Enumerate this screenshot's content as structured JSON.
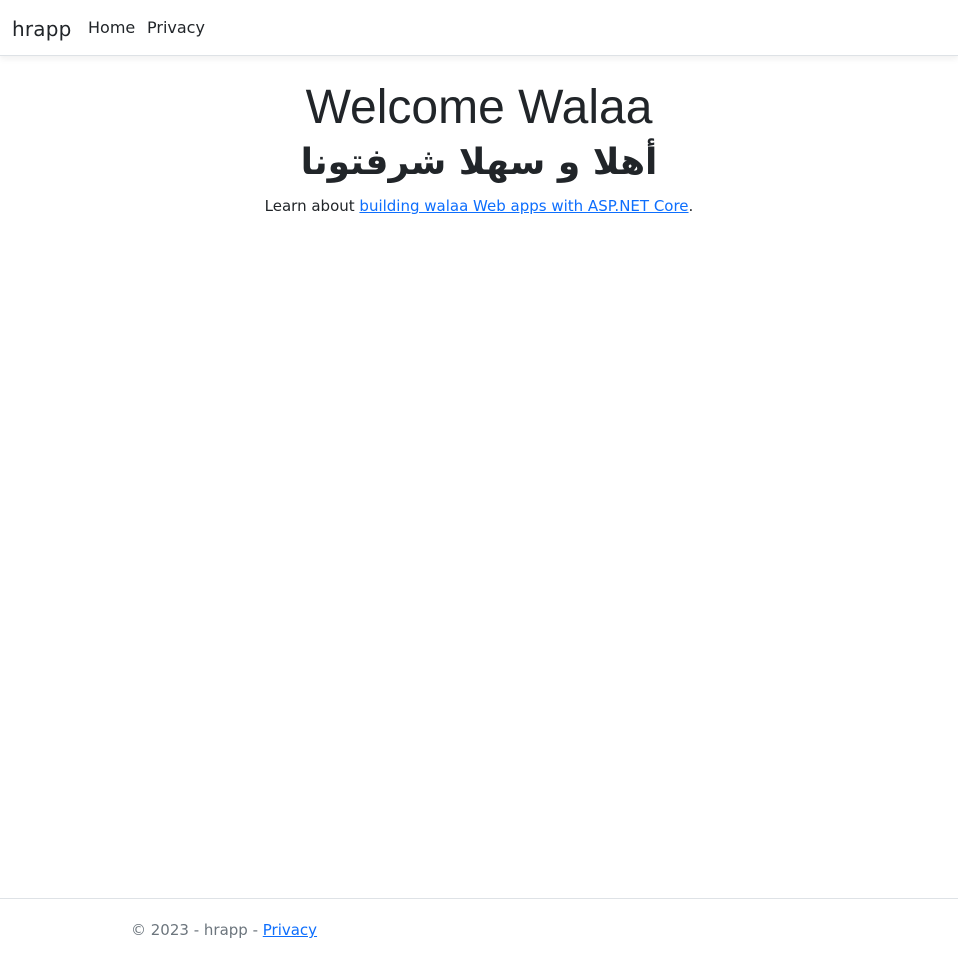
{
  "navbar": {
    "brand": "hrapp",
    "links": [
      {
        "label": "Home"
      },
      {
        "label": "Privacy"
      }
    ]
  },
  "main": {
    "title": "Welcome Walaa",
    "arabic_heading": "أهلا و سهلا شرفتونا",
    "learn_prefix": "Learn about ",
    "learn_link": "building walaa Web apps with ASP.NET Core",
    "learn_suffix": "."
  },
  "footer": {
    "copyright": "© 2023 - hrapp - ",
    "privacy_link": "Privacy"
  },
  "colors": {
    "link": "#0d6efd",
    "text": "#212529",
    "muted": "#6c757d",
    "border": "#dee2e6"
  }
}
